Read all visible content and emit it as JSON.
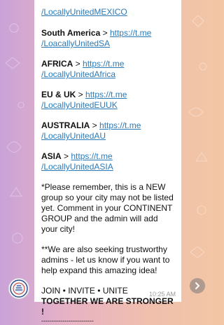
{
  "colors": {
    "link": "#2a7ab8",
    "time": "#9a9a9a",
    "bubble": "#ffffff"
  },
  "message": {
    "top_link": "/LocallyUnitedMEXICO",
    "regions": [
      {
        "label": "South America",
        "sep": " > ",
        "link_part1": "https://t.me",
        "link_part2": "/LoacallyUnitedSA"
      },
      {
        "label": "AFRICA",
        "sep": " > ",
        "link_part1": "https://t.me",
        "link_part2": "/LocallyUnitedAfrica"
      },
      {
        "label": "EU & UK",
        "sep": " > ",
        "link_part1": "https://t.me",
        "link_part2": "/LocallyUnitedEUUK"
      },
      {
        "label": "AUSTRALIA",
        "sep": " > ",
        "link_part1": "https://t.me",
        "link_part2": "/LocallyUnitedAU"
      },
      {
        "label": "ASIA",
        "sep": " > ",
        "link_part1": "https://t.me",
        "link_part2": "/LocallyUnitedASIA"
      }
    ],
    "note1": "*Please remember, this is a NEW group so your city may not be listed yet. Comment in your CONTINENT GROUP and the admin will add your city!",
    "note2": "**We are also seeking trustworthy admins - let us know if you want to help expand this amazing idea!",
    "slogan1": "JOIN • INVITE • UNITE",
    "slogan2": "TOGETHER WE ARE STRONGER !",
    "divider": "-------------------------",
    "time": "10:25 AM"
  },
  "icons": {
    "avatar": "channel-logo-icon",
    "share": "share-arrow-icon"
  }
}
